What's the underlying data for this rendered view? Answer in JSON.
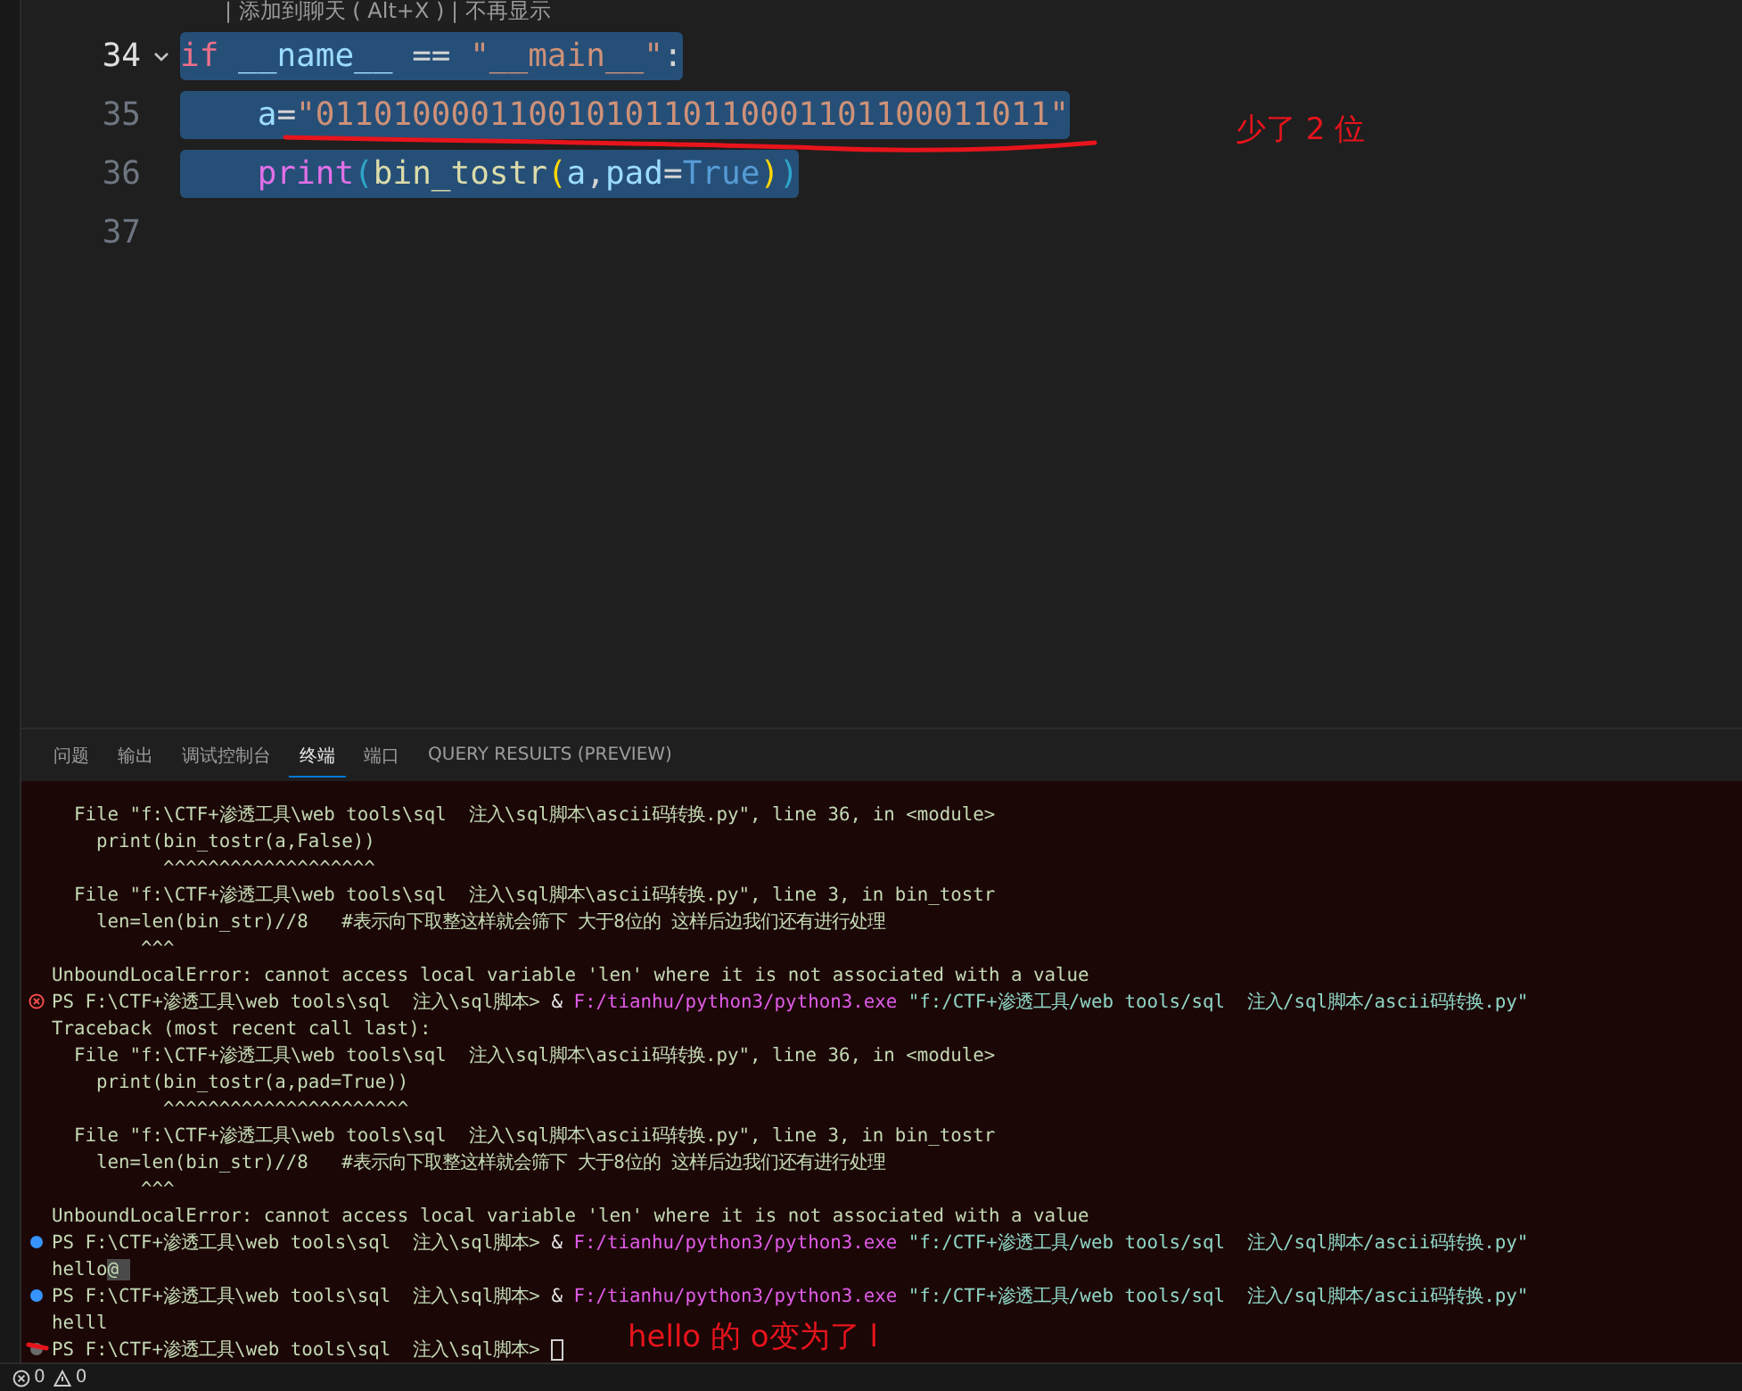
{
  "codelens": "| 添加到聊天 ( Alt+X ) | 不再显示",
  "code_lines": [
    {
      "number": "34",
      "current": true,
      "foldable": true,
      "selected": true,
      "tokens": [
        {
          "text": "if",
          "kind": "keyword"
        },
        {
          "text": " __name__",
          "kind": "variable"
        },
        {
          "text": " ==",
          "kind": "operator"
        },
        {
          "text": " \"__main__\"",
          "kind": "string"
        },
        {
          "text": ":",
          "kind": "operator"
        }
      ]
    },
    {
      "number": "35",
      "current": false,
      "foldable": false,
      "selected": true,
      "tokens": [
        {
          "text": "    a",
          "kind": "variable"
        },
        {
          "text": "=",
          "kind": "operator"
        },
        {
          "text": "\"01101000011001010110110001101100011011\"",
          "kind": "string"
        }
      ]
    },
    {
      "number": "36",
      "current": false,
      "foldable": false,
      "selected": true,
      "tokens": [
        {
          "text": "    print",
          "kind": "builtin"
        },
        {
          "text": "(",
          "kind": "bracket1"
        },
        {
          "text": "bin_tostr",
          "kind": "function"
        },
        {
          "text": "(",
          "kind": "bracket2"
        },
        {
          "text": "a",
          "kind": "variable"
        },
        {
          "text": ",",
          "kind": "operator"
        },
        {
          "text": "pad",
          "kind": "variable"
        },
        {
          "text": "=",
          "kind": "operator"
        },
        {
          "text": "True",
          "kind": "constant"
        },
        {
          "text": ")",
          "kind": "bracket2"
        },
        {
          "text": ")",
          "kind": "bracket1"
        }
      ]
    },
    {
      "number": "37",
      "current": false,
      "foldable": false
    }
  ],
  "annotations": {
    "editor_note": "少了 2 位",
    "terminal_note": "hello 的 o变为了 l"
  },
  "panel_tabs": [
    {
      "label": "问题",
      "selected": false
    },
    {
      "label": "输出",
      "selected": false
    },
    {
      "label": "调试控制台",
      "selected": false
    },
    {
      "label": "终端",
      "selected": true
    },
    {
      "label": "端口",
      "selected": false
    },
    {
      "label": "QUERY RESULTS (PREVIEW)",
      "selected": false
    }
  ],
  "terminal_lines": [
    {
      "kind": "output",
      "segments": [
        {
          "text": "  File \"f:\\CTF+渗透工具\\web tools\\sql  注入\\sql脚本\\ascii码转换.py\", line 36, in <module>",
          "kind": "plain"
        }
      ]
    },
    {
      "kind": "output",
      "segments": [
        {
          "text": "    print(bin_tostr(a,False))",
          "kind": "plain"
        }
      ]
    },
    {
      "kind": "output",
      "segments": [
        {
          "text": "          ^^^^^^^^^^^^^^^^^^^",
          "kind": "plain"
        }
      ]
    },
    {
      "kind": "output",
      "segments": [
        {
          "text": "  File \"f:\\CTF+渗透工具\\web tools\\sql  注入\\sql脚本\\ascii码转换.py\", line 3, in bin_tostr",
          "kind": "plain"
        }
      ]
    },
    {
      "kind": "output",
      "segments": [
        {
          "text": "    len=len(bin_str)//8   #表示向下取整这样就会筛下 大于8位的 这样后边我们还有进行处理",
          "kind": "plain"
        }
      ]
    },
    {
      "kind": "output",
      "segments": [
        {
          "text": "        ^^^",
          "kind": "plain"
        }
      ]
    },
    {
      "kind": "output",
      "segments": [
        {
          "text": "UnboundLocalError: cannot access local variable 'len' where it is not associated with a value",
          "kind": "plain"
        }
      ]
    },
    {
      "kind": "prompt",
      "failed": true,
      "color": "#f14c4c",
      "cursor": false,
      "segments": [
        {
          "text": "PS F:\\CTF+渗透工具\\web tools\\sql  注入\\sql脚本> ",
          "kind": "plain"
        },
        {
          "text": "& ",
          "kind": "operator"
        },
        {
          "text": "F:/tianhu/python3/python3.exe",
          "kind": "exe"
        },
        {
          "text": " \"f:/CTF+渗透工具/web tools/sql  注入/sql脚本/ascii码转换.py\"",
          "kind": "arg"
        }
      ]
    },
    {
      "kind": "output",
      "segments": [
        {
          "text": "Traceback (most recent call last):",
          "kind": "plain"
        }
      ]
    },
    {
      "kind": "output",
      "segments": [
        {
          "text": "  File \"f:\\CTF+渗透工具\\web tools\\sql  注入\\sql脚本\\ascii码转换.py\", line 36, in <module>",
          "kind": "plain"
        }
      ]
    },
    {
      "kind": "output",
      "segments": [
        {
          "text": "    print(bin_tostr(a,pad=True))",
          "kind": "plain"
        }
      ]
    },
    {
      "kind": "output",
      "segments": [
        {
          "text": "          ^^^^^^^^^^^^^^^^^^^^^^",
          "kind": "plain"
        }
      ]
    },
    {
      "kind": "output",
      "segments": [
        {
          "text": "  File \"f:\\CTF+渗透工具\\web tools\\sql  注入\\sql脚本\\ascii码转换.py\", line 3, in bin_tostr",
          "kind": "plain"
        }
      ]
    },
    {
      "kind": "output",
      "segments": [
        {
          "text": "    len=len(bin_str)//8   #表示向下取整这样就会筛下 大于8位的 这样后边我们还有进行处理",
          "kind": "plain"
        }
      ]
    },
    {
      "kind": "output",
      "segments": [
        {
          "text": "        ^^^",
          "kind": "plain"
        }
      ]
    },
    {
      "kind": "output",
      "segments": [
        {
          "text": "UnboundLocalError: cannot access local variable 'len' where it is not associated with a value",
          "kind": "plain"
        }
      ]
    },
    {
      "kind": "prompt",
      "failed": false,
      "color": "#3794ff",
      "cursor": false,
      "segments": [
        {
          "text": "PS F:\\CTF+渗透工具\\web tools\\sql  注入\\sql脚本> ",
          "kind": "plain"
        },
        {
          "text": "& ",
          "kind": "operator"
        },
        {
          "text": "F:/tianhu/python3/python3.exe",
          "kind": "exe"
        },
        {
          "text": " \"f:/CTF+渗透工具/web tools/sql  注入/sql脚本/ascii码转换.py\"",
          "kind": "arg"
        }
      ]
    },
    {
      "kind": "output",
      "segments": [
        {
          "text": "hello",
          "kind": "plain"
        },
        {
          "text": "@ ",
          "kind": "highlight"
        }
      ]
    },
    {
      "kind": "prompt",
      "failed": false,
      "color": "#3794ff",
      "cursor": false,
      "segments": [
        {
          "text": "PS F:\\CTF+渗透工具\\web tools\\sql  注入\\sql脚本> ",
          "kind": "plain"
        },
        {
          "text": "& ",
          "kind": "operator"
        },
        {
          "text": "F:/tianhu/python3/python3.exe",
          "kind": "exe"
        },
        {
          "text": " \"f:/CTF+渗透工具/web tools/sql  注入/sql脚本/ascii码转换.py\"",
          "kind": "arg"
        }
      ]
    },
    {
      "kind": "output",
      "segments": [
        {
          "text": "helll",
          "kind": "plain"
        }
      ]
    },
    {
      "kind": "prompt",
      "failed": false,
      "color": "#6a6a6a",
      "cursor": true,
      "segments": [
        {
          "text": "PS F:\\CTF+渗透工具\\web tools\\sql  注入\\sql脚本> ",
          "kind": "plain"
        }
      ]
    }
  ],
  "status_bar": {
    "errors": "0",
    "warnings": "0"
  }
}
